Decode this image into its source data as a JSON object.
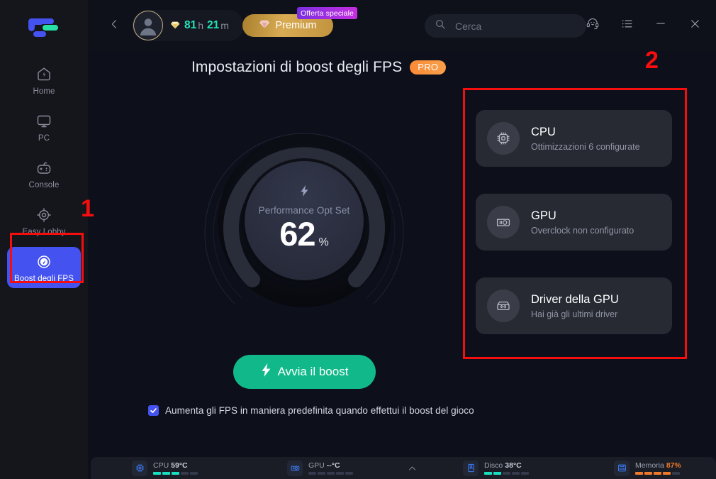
{
  "sidebar": {
    "logo_name": "lulubox-logo",
    "items": [
      {
        "label": "Home",
        "icon": "home-icon",
        "active": false
      },
      {
        "label": "PC",
        "icon": "monitor-icon",
        "active": false
      },
      {
        "label": "Console",
        "icon": "gamepad-icon",
        "active": false
      },
      {
        "label": "Easy Lobby",
        "icon": "target-icon",
        "active": false
      },
      {
        "label": "Boost degli FPS",
        "icon": "speedometer-icon",
        "active": true
      }
    ]
  },
  "topbar": {
    "back_icon": "chevron-left-icon",
    "user": {
      "avatar_icon": "user-avatar-icon",
      "gem_icon": "diamond-icon",
      "hours": "81",
      "hours_unit": "h",
      "minutes": "21",
      "minutes_unit": "m"
    },
    "premium_label": "Premium",
    "premium_icon": "diamond-icon",
    "offer_badge": "Offerta speciale",
    "search": {
      "placeholder": "Cerca",
      "value": "",
      "icon": "search-icon"
    },
    "window_controls": [
      {
        "name": "support-headset-icon"
      },
      {
        "name": "list-menu-icon"
      },
      {
        "name": "minimize-icon"
      },
      {
        "name": "close-icon"
      }
    ]
  },
  "main": {
    "title": "Impostazioni di boost degli FPS",
    "pro_badge": "PRO",
    "gauge": {
      "bolt_icon": "lightning-bolt-icon",
      "label": "Performance Opt Set",
      "value": "62",
      "unit": "%"
    },
    "boost_button": {
      "label": "Avvia il boost",
      "icon": "lightning-bolt-icon"
    },
    "checkbox": {
      "checked": true,
      "label": "Aumenta gli FPS in maniera predefinita quando effettui il boost del gioco"
    }
  },
  "cards": [
    {
      "title": "CPU",
      "subtitle": "Ottimizzazioni 6 configurate",
      "icon": "cpu-chip-icon"
    },
    {
      "title": "GPU",
      "subtitle": "Overclock non configurato",
      "icon": "gpu-card-icon"
    },
    {
      "title": "Driver della GPU",
      "subtitle": "Hai già gli ultimi driver",
      "icon": "driver-box-icon"
    }
  ],
  "statusbar": {
    "expand_icon": "chevron-up-icon",
    "stats": [
      {
        "icon": "cpu-chip-icon",
        "label": "CPU",
        "value": "59°C",
        "segments_on": 3,
        "segments_total": 5,
        "color": "cyan"
      },
      {
        "icon": "gpu-card-icon",
        "label": "GPU",
        "value": "--°C",
        "segments_on": 0,
        "segments_total": 5,
        "color": "cyan"
      },
      {
        "icon": "disk-icon",
        "label": "Disco",
        "value": "38°C",
        "segments_on": 2,
        "segments_total": 5,
        "color": "cyan"
      },
      {
        "icon": "memory-icon",
        "label": "Memoria",
        "value": "87%",
        "segments_on": 4,
        "segments_total": 5,
        "color": "orange"
      }
    ]
  },
  "annotations": [
    {
      "number": "1",
      "target": "sidebar-item-boost-fps"
    },
    {
      "number": "2",
      "target": "cards-panel"
    }
  ],
  "colors": {
    "accent_blue": "#4452f0",
    "accent_green": "#11b98a",
    "accent_cyan": "#17dfc0",
    "accent_orange": "#f07a2a",
    "pro_orange": "#fb8a36",
    "premium_gold": "#d9ab53",
    "offer_purple": "#a02ee0",
    "annotation_red": "#f60d0d",
    "background": "#0d101a",
    "sidebar_bg": "#15161c",
    "card_bg": "#272a33"
  }
}
